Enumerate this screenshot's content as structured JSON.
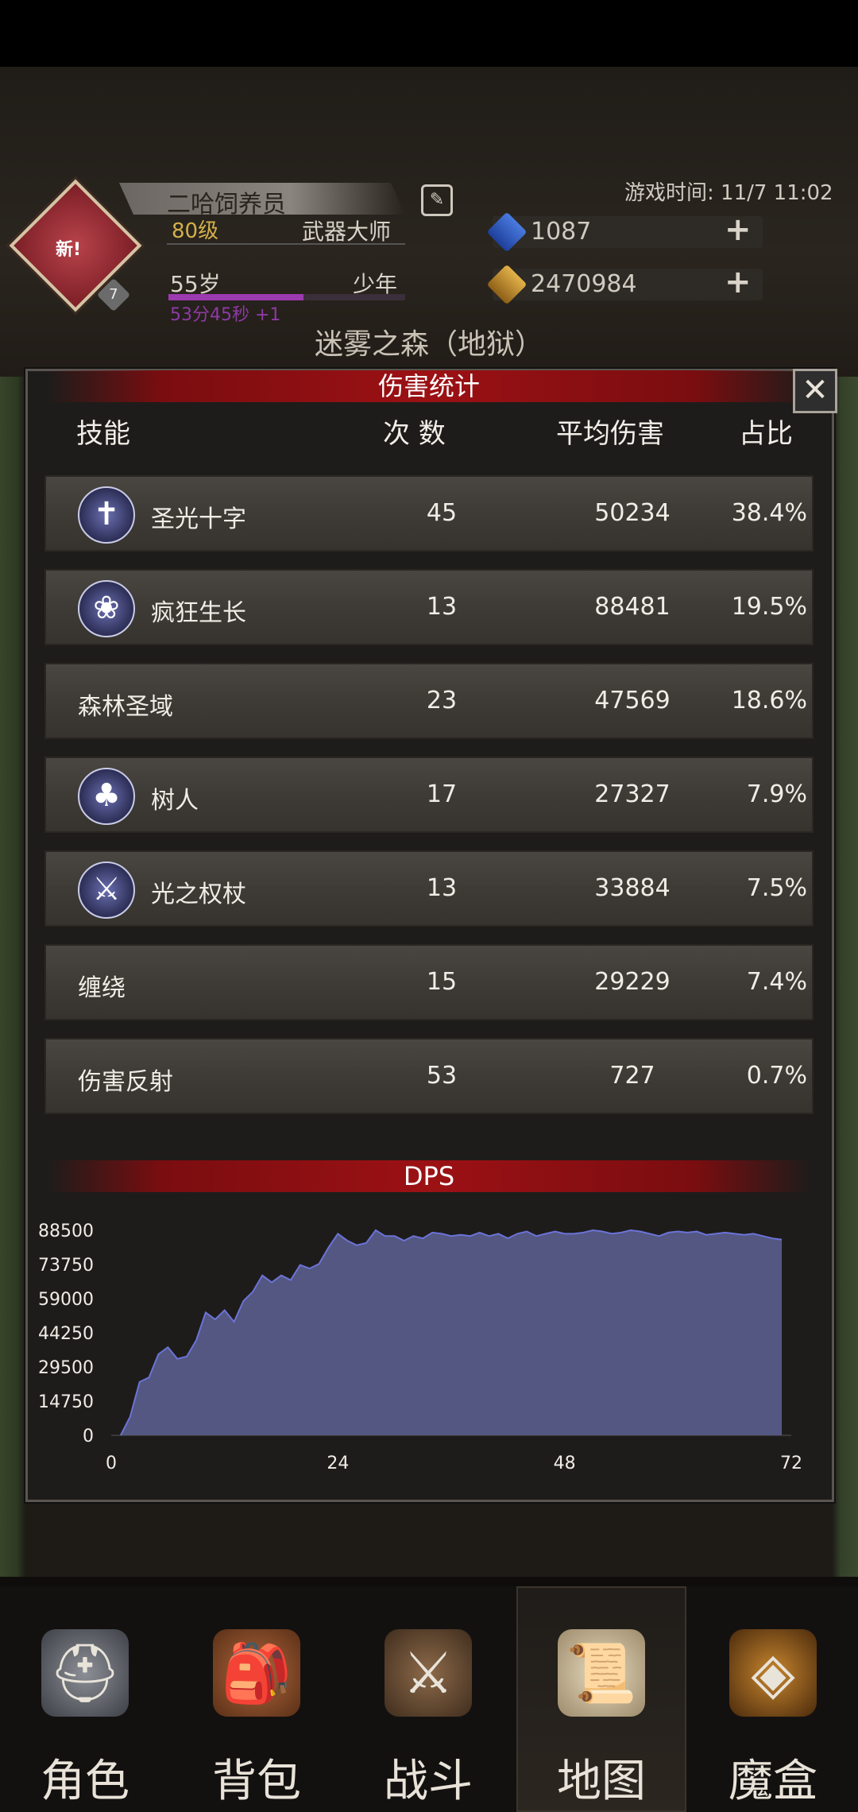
{
  "header": {
    "player_name": "二哈饲养员",
    "level": "80级",
    "title": "武器大师",
    "age": "55岁",
    "stage": "少年",
    "timer": "53分45秒 +1",
    "emblem_badge": "新!",
    "emblem_count": "7",
    "game_time": "游戏时间: 11/7 11:02",
    "gems": "1087",
    "gold": "2470984",
    "map_name": "迷雾之森（地狱）"
  },
  "modal": {
    "title": "伤害统计",
    "close_label": "✕",
    "columns": [
      "技能",
      "次 数",
      "平均伤害",
      "占比"
    ],
    "rows": [
      {
        "name": "圣光十字",
        "count": "45",
        "avg": "50234",
        "pct": "38.4%",
        "icon": "holy-cross-icon"
      },
      {
        "name": "疯狂生长",
        "count": "13",
        "avg": "88481",
        "pct": "19.5%",
        "icon": "wild-growth-icon"
      },
      {
        "name": "森林圣域",
        "count": "23",
        "avg": "47569",
        "pct": "18.6%",
        "icon": ""
      },
      {
        "name": "树人",
        "count": "17",
        "avg": "27327",
        "pct": "7.9%",
        "icon": "treant-icon"
      },
      {
        "name": "光之权杖",
        "count": "13",
        "avg": "33884",
        "pct": "7.5%",
        "icon": "light-scepter-icon"
      },
      {
        "name": "缠绕",
        "count": "15",
        "avg": "29229",
        "pct": "7.4%",
        "icon": ""
      },
      {
        "name": "伤害反射",
        "count": "53",
        "avg": "727",
        "pct": "0.7%",
        "icon": ""
      }
    ]
  },
  "chart_data": {
    "type": "area",
    "title": "DPS",
    "xlim": [
      0,
      72
    ],
    "ylim": [
      0,
      88500
    ],
    "x_ticks": [
      "0",
      "24",
      "48",
      "72"
    ],
    "y_ticks": [
      "88500",
      "73750",
      "59000",
      "44250",
      "29500",
      "14750",
      "0"
    ],
    "color": "#535781",
    "x": [
      1,
      2,
      3,
      4,
      5,
      6,
      7,
      8,
      9,
      10,
      11,
      12,
      13,
      14,
      15,
      16,
      17,
      18,
      19,
      20,
      21,
      22,
      23,
      24,
      25,
      26,
      27,
      28,
      29,
      30,
      31,
      32,
      33,
      34,
      35,
      36,
      37,
      38,
      39,
      40,
      41,
      42,
      43,
      44,
      45,
      46,
      47,
      48,
      49,
      50,
      51,
      52,
      53,
      54,
      55,
      56,
      57,
      58,
      59,
      60,
      61,
      62,
      63,
      64,
      65,
      66,
      67,
      68,
      69,
      70,
      71
    ],
    "values": [
      0,
      8000,
      23000,
      25000,
      35000,
      38000,
      33000,
      34000,
      41000,
      53000,
      50000,
      54000,
      49000,
      58000,
      62000,
      69000,
      66000,
      69000,
      67000,
      73500,
      72000,
      74000,
      81000,
      87000,
      84000,
      82000,
      83000,
      88500,
      86000,
      86000,
      84000,
      86000,
      85000,
      87500,
      87000,
      86000,
      86500,
      86000,
      87500,
      86000,
      87000,
      85000,
      87000,
      88000,
      86000,
      87000,
      88000,
      87000,
      87000,
      87500,
      88500,
      88000,
      87000,
      87500,
      88500,
      88000,
      87000,
      86000,
      87500,
      88000,
      87500,
      88000,
      86500,
      87000,
      87500,
      87000,
      86500,
      87000,
      86000,
      85000,
      84500
    ]
  },
  "nav": {
    "items": [
      {
        "label": "角色",
        "icon": "helmet-icon"
      },
      {
        "label": "背包",
        "icon": "backpack-icon"
      },
      {
        "label": "战斗",
        "icon": "sword-shield-icon"
      },
      {
        "label": "地图",
        "icon": "scroll-map-icon"
      },
      {
        "label": "魔盒",
        "icon": "magic-box-icon"
      }
    ],
    "active_index": 3
  }
}
